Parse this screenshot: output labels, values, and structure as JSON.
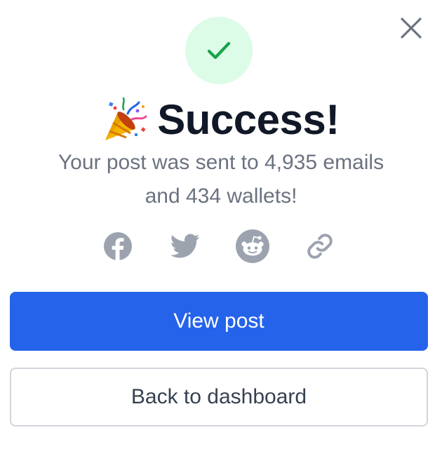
{
  "modal": {
    "title": "Success!",
    "message_line1": "Your post was sent to 4,935 emails",
    "message_line2": "and 434 wallets!",
    "close_icon": "close-icon",
    "status_icon": "check-icon",
    "title_icon": "party-popper-icon"
  },
  "share": {
    "items": [
      {
        "icon": "facebook-icon"
      },
      {
        "icon": "twitter-icon"
      },
      {
        "icon": "reddit-icon"
      },
      {
        "icon": "link-icon"
      }
    ]
  },
  "actions": {
    "primary_label": "View post",
    "secondary_label": "Back to dashboard"
  },
  "colors": {
    "primary": "#2563eb",
    "success_bg": "#dcfce7",
    "success_check": "#16a34a",
    "icon_gray": "#9ca3af",
    "title": "#111827",
    "muted_text": "#6b7280"
  }
}
